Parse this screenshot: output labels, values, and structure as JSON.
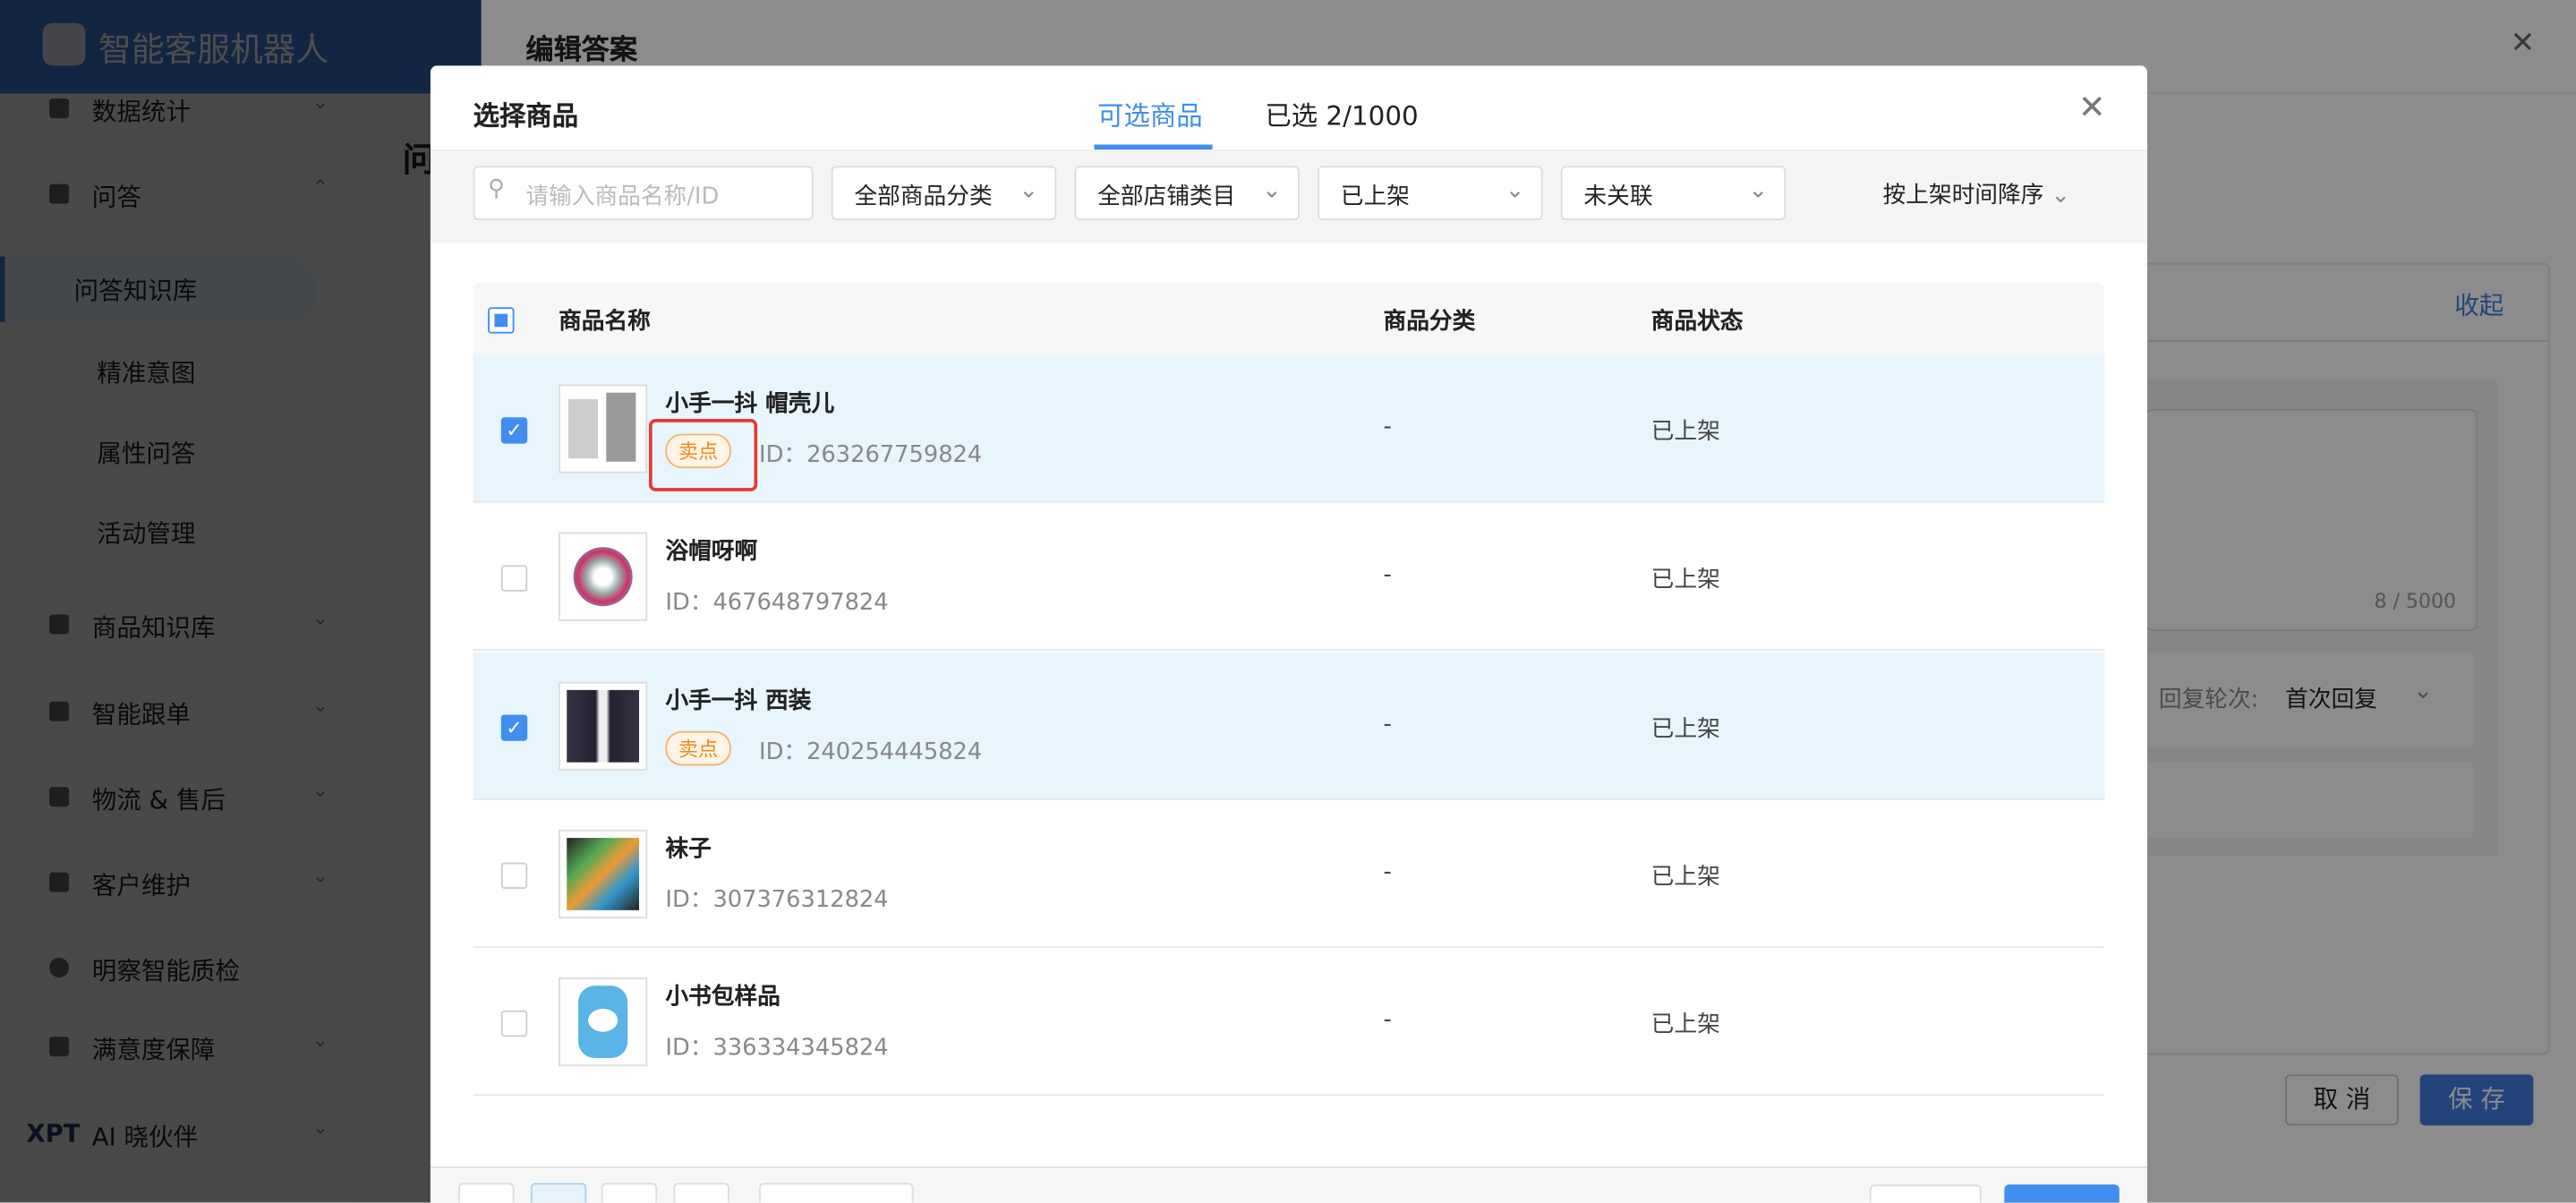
{
  "app": {
    "title": "智能客服机器人"
  },
  "sidebar": {
    "items": [
      {
        "label": "数据统计",
        "chevron": "⌄"
      },
      {
        "label": "问答",
        "chevron": "⌃"
      },
      {
        "label": "问答知识库"
      },
      {
        "label": "精准意图"
      },
      {
        "label": "属性问答"
      },
      {
        "label": "活动管理"
      },
      {
        "label": "商品知识库",
        "chevron": "⌄"
      },
      {
        "label": "智能跟单",
        "chevron": "⌄"
      },
      {
        "label": "物流 & 售后",
        "chevron": "⌄"
      },
      {
        "label": "客户维护",
        "chevron": "⌄"
      },
      {
        "label": "明察智能质检"
      },
      {
        "label": "满意度保障",
        "chevron": "⌄"
      },
      {
        "label": "AI 晓伙伴",
        "logo": "XPT",
        "chevron": "⌄"
      }
    ]
  },
  "main": {
    "title_partial": "问"
  },
  "drawer": {
    "title": "编辑答案",
    "close": "✕",
    "collapse": "收起",
    "counter": "8 / 5000",
    "reply_round_label": "回复轮次:",
    "reply_round_value": "首次回复",
    "cancel": "取 消",
    "save": "保 存"
  },
  "modal": {
    "title": "选择商品",
    "tabs": [
      {
        "label": "可选商品",
        "active": true
      },
      {
        "label": "已选 2/1000"
      }
    ],
    "close": "✕",
    "search_placeholder": "请输入商品名称/ID",
    "filters": [
      "全部商品分类",
      "全部店铺类目",
      "已上架",
      "未关联"
    ],
    "sort": "按上架时间降序",
    "columns": [
      "商品名称",
      "商品分类",
      "商品状态"
    ],
    "rows": [
      {
        "name": "小手一抖 帽壳儿",
        "tag": "卖点",
        "id": "ID：263267759824",
        "category": "-",
        "status": "已上架",
        "checked": true
      },
      {
        "name": "浴帽呀啊",
        "id": "ID：467648797824",
        "category": "-",
        "status": "已上架",
        "checked": false
      },
      {
        "name": "小手一抖 西装",
        "tag": "卖点",
        "id": "ID：240254445824",
        "category": "-",
        "status": "已上架",
        "checked": true
      },
      {
        "name": "袜子",
        "id": "ID：307376312824",
        "category": "-",
        "status": "已上架",
        "checked": false
      },
      {
        "name": "小书包样品",
        "id": "ID：336334345824",
        "category": "-",
        "status": "已上架",
        "checked": false
      }
    ]
  },
  "colors": {
    "primary": "#3f8ef0",
    "selected_row": "#e8f5fd",
    "tag": "#f08a1c",
    "annotation": "#e53935"
  }
}
